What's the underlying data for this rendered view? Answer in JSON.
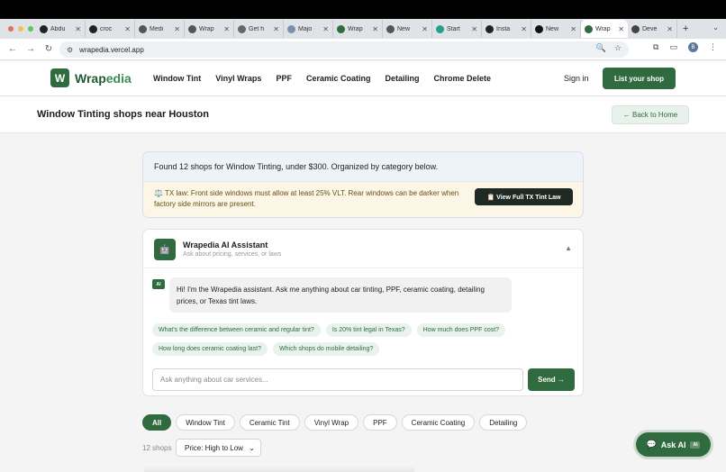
{
  "browser": {
    "tabs": [
      {
        "label": "Abdu",
        "favicon": "github-icon"
      },
      {
        "label": "croc",
        "favicon": "github-icon"
      },
      {
        "label": "Medi",
        "favicon": "globe-icon"
      },
      {
        "label": "Wrap",
        "favicon": "globe-icon"
      },
      {
        "label": "Get h",
        "favicon": "document-icon"
      },
      {
        "label": "Majo",
        "favicon": "shield-icon"
      },
      {
        "label": "Wrap",
        "favicon": "wrapedia-icon"
      },
      {
        "label": "New",
        "favicon": "globe-icon"
      },
      {
        "label": "Start",
        "favicon": "diamond-icon"
      },
      {
        "label": "Insta",
        "favicon": "github-icon"
      },
      {
        "label": "New",
        "favicon": "a-icon"
      },
      {
        "label": "Wrap",
        "favicon": "wrapedia-icon",
        "active": true
      },
      {
        "label": "Deve",
        "favicon": "discord-icon"
      }
    ],
    "url": "wrapedia.vercel.app",
    "profile_initial": "B"
  },
  "site": {
    "logo_letter": "W",
    "logo_text_a": "Wrap",
    "logo_text_b": "edia",
    "nav": [
      "Window Tint",
      "Vinyl Wraps",
      "PPF",
      "Ceramic Coating",
      "Detailing",
      "Chrome Delete"
    ],
    "sign_in": "Sign in",
    "list_shop": "List your shop"
  },
  "page": {
    "title": "Window Tinting shops near Houston",
    "back_home": "← Back to Home"
  },
  "info": {
    "summary": "Found 12 shops for Window Tinting, under $300. Organized by category below.",
    "law_text": "⚖️ TX law: Front side windows must allow at least 25% VLT. Rear windows can be darker when factory side mirrors are present.",
    "law_button": "📋 View Full TX Tint Law"
  },
  "assistant": {
    "title": "Wrapedia AI Assistant",
    "subtitle": "Ask about pricing, services, or laws",
    "ai_badge": "AI",
    "greeting": "Hi! I'm the Wrapedia assistant. Ask me anything about car tinting, PPF, ceramic coating, detailing prices, or Texas tint laws.",
    "suggestions": [
      "What's the difference between ceramic and regular tint?",
      "Is 20% tint legal in Texas?",
      "How much does PPF cost?",
      "How long does ceramic coating last?",
      "Which shops do mobile detailing?"
    ],
    "input_placeholder": "Ask anything about car services...",
    "send": "Send →"
  },
  "filters": {
    "pills": [
      "All",
      "Window Tint",
      "Ceramic Tint",
      "Vinyl Wrap",
      "PPF",
      "Ceramic Coating",
      "Detailing"
    ],
    "active": "All",
    "count_text": "12 shops",
    "sort_value": "Price: High to Low"
  },
  "floating": {
    "ask_ai": "Ask AI",
    "badge": "AI"
  },
  "colors": {
    "brand": "#2f6b3f",
    "law_bg": "#fbf6e6",
    "info_bg": "#eef3f9"
  }
}
